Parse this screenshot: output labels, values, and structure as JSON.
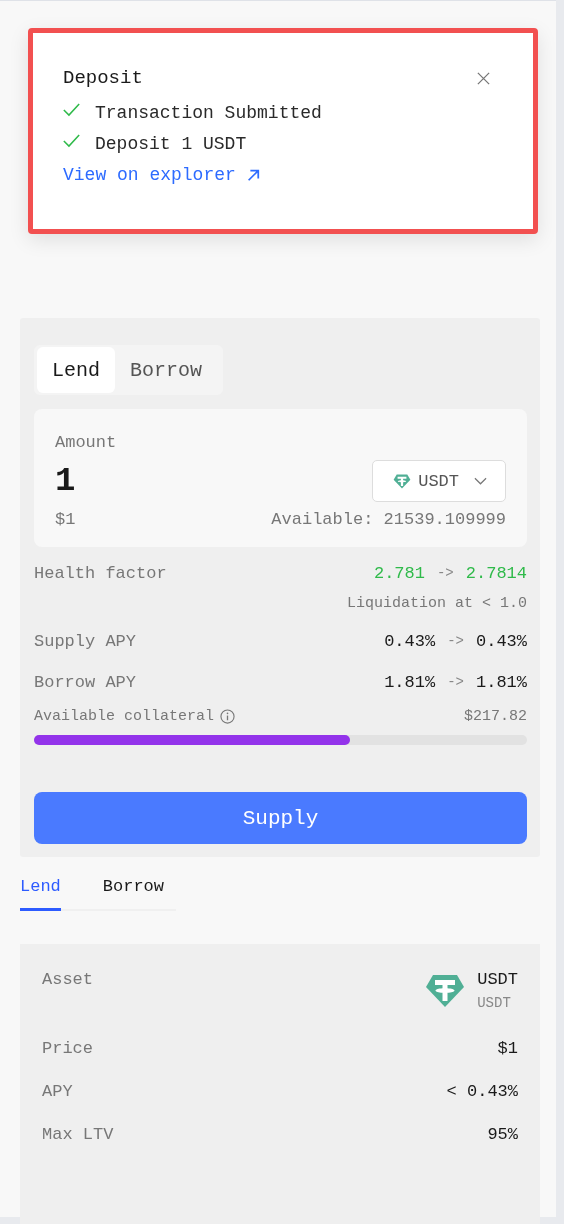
{
  "toast": {
    "title": "Deposit",
    "highlighted": true,
    "steps": [
      {
        "text": "Transaction Submitted",
        "done": true
      },
      {
        "text": "Deposit 1 USDT",
        "done": true
      }
    ],
    "link": "View on explorer"
  },
  "form": {
    "tabs": [
      {
        "label": "Lend",
        "selected": true
      },
      {
        "label": "Borrow",
        "selected": false
      }
    ],
    "amount": {
      "label": "Amount",
      "value": "1",
      "usd": "$1",
      "available": "Available: 21539.109999",
      "token": "USDT"
    },
    "stats": [
      {
        "kind": "change",
        "label": "Health factor",
        "from": "2.781",
        "arrow": "->",
        "to": "2.7814",
        "color": "#2fba4a"
      },
      {
        "kind": "note",
        "text": "Liquidation at < 1.0"
      },
      {
        "kind": "change",
        "label": "Supply APY",
        "from": "0.43%",
        "arrow": "->",
        "to": "0.43%",
        "color": "#1a1a1a"
      },
      {
        "kind": "change",
        "label": "Borrow APY",
        "from": "1.81%",
        "arrow": "->",
        "to": "1.81%",
        "color": "#1a1a1a"
      }
    ],
    "collateral": {
      "label": "Available collateral",
      "value": "$217.82",
      "level": 0.64
    },
    "submit": "Supply"
  },
  "detail_tabs": [
    {
      "label": "Lend",
      "selected": true
    },
    {
      "label": "Borrow",
      "selected": false
    }
  ],
  "details": {
    "asset": {
      "label": "Asset",
      "symbol": "USDT",
      "name": "USDT"
    },
    "rows": [
      {
        "label": "Price",
        "value": "$1"
      },
      {
        "label": "APY",
        "value": "< 0.43%"
      },
      {
        "label": "Max LTV",
        "value": "95%"
      }
    ]
  }
}
